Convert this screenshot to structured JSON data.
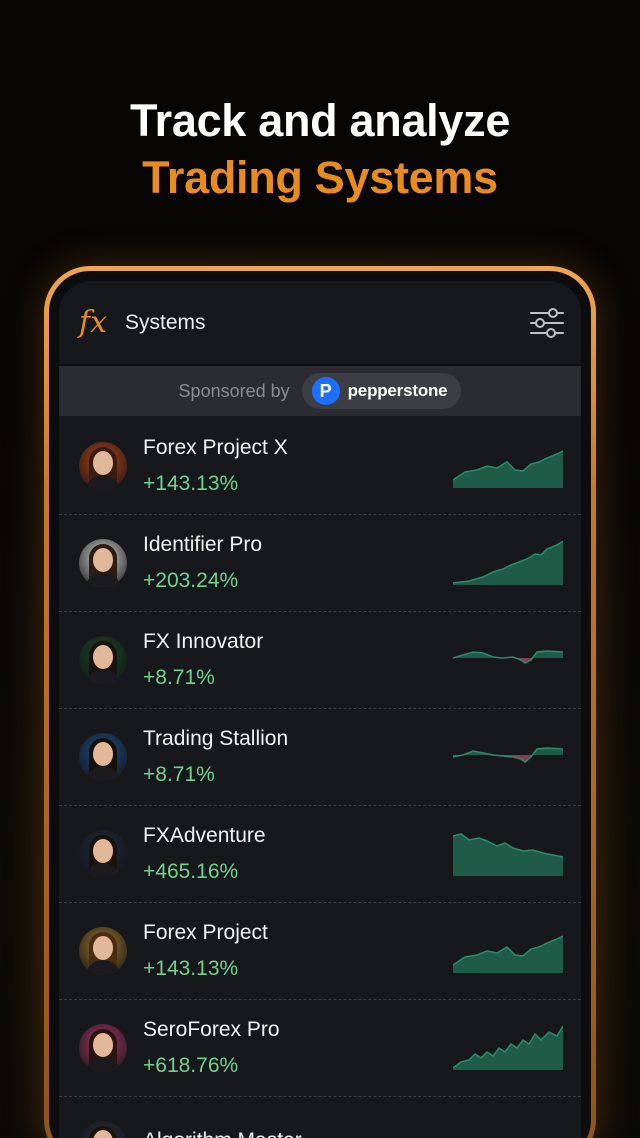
{
  "headline": {
    "line1": "Track and analyze",
    "line2": "Trading Systems"
  },
  "colors": {
    "accent": "#e88c1f",
    "gain": "#6ed38f",
    "spark_fill": "#1f5c48",
    "spark_line": "#2d8b69",
    "spark_neg": "#8a3a55"
  },
  "appbar": {
    "logo": "fx",
    "title": "Systems",
    "filter_icon": "sliders-icon"
  },
  "sponsor": {
    "label": "Sponsored by",
    "brand": "pepperstone",
    "brand_badge": "P"
  },
  "systems": [
    {
      "name": "Forex Project X",
      "gain": "+143.13%",
      "avatar_bg": "#b8461c",
      "hair": "#3a1c10"
    },
    {
      "name": "Identifier Pro",
      "gain": "+203.24%",
      "avatar_bg": "#d8d8d8",
      "hair": "#2b1c14"
    },
    {
      "name": "FX Innovator",
      "gain": "+8.71%",
      "avatar_bg": "#1b4a2a",
      "hair": "#1a120c"
    },
    {
      "name": "Trading Stallion",
      "gain": "+8.71%",
      "avatar_bg": "#1e4f8a",
      "hair": "#15100c"
    },
    {
      "name": "FXAdventure",
      "gain": "+465.16%",
      "avatar_bg": "#1f2b44",
      "hair": "#1a110b"
    },
    {
      "name": "Forex Project",
      "gain": "+143.13%",
      "avatar_bg": "#9a7a2e",
      "hair": "#4a2c14"
    },
    {
      "name": "SeroForex Pro",
      "gain": "+618.76%",
      "avatar_bg": "#a63a6a",
      "hair": "#2a1410"
    },
    {
      "name": "Algorithm Master",
      "gain": "",
      "avatar_bg": "#2a2f3a",
      "hair": "#1a120c"
    }
  ]
}
